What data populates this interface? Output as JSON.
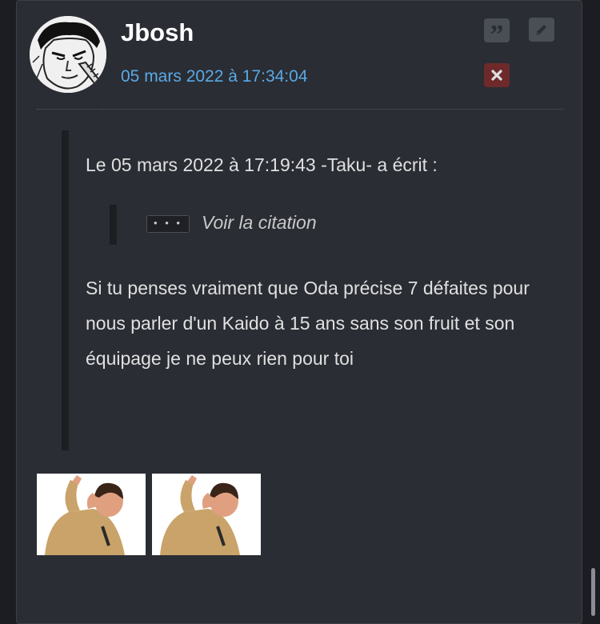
{
  "post": {
    "author": "Jbosh",
    "date": "05 mars 2022 à 17:34:04",
    "quote": {
      "header": "Le 05 mars 2022 à 17:19:43 -Taku- a écrit :",
      "nested": {
        "expand_label": "• • •",
        "link_text": "Voir la citation"
      },
      "body": "Si tu penses vraiment que Oda précise 7 défaites pour nous parler d'un Kaido à 15 ans sans son fruit et son équipage je ne peux rien pour toi"
    },
    "actions": [
      {
        "name": "quote-button",
        "icon": "quote-icon",
        "color": "#4a4e55"
      },
      {
        "name": "edit-button",
        "icon": "pencil-icon",
        "color": "#4a4e55"
      },
      {
        "name": "delete-button",
        "icon": "close-icon",
        "color": "#6e2a2a"
      }
    ],
    "stickers": [
      {
        "icon": "sticker-image"
      },
      {
        "icon": "sticker-image"
      }
    ]
  },
  "colors": {
    "background": "#2a2d34",
    "author": "#ffffff",
    "date": "#5aa9e6",
    "text": "#e0e0e0",
    "delete": "#b33a3a"
  }
}
